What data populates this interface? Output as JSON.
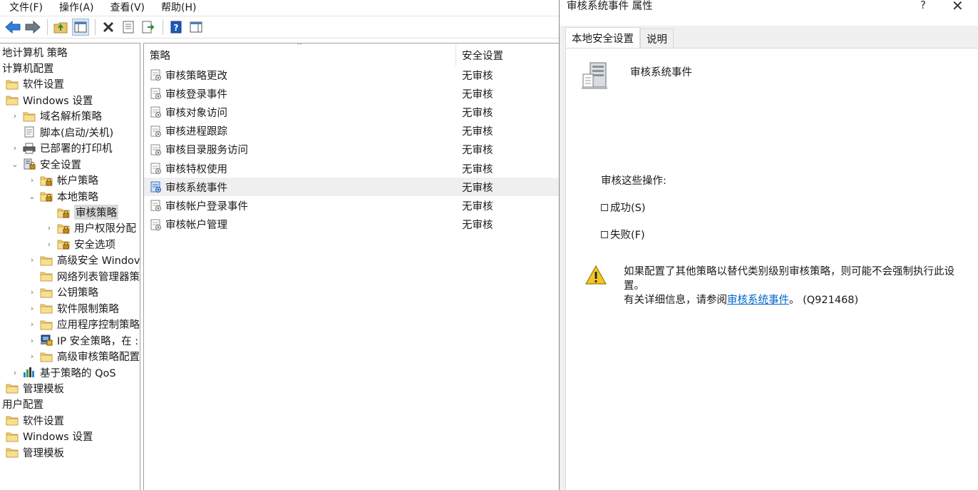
{
  "menu": [
    "文件(F)",
    "操作(A)",
    "查看(V)",
    "帮助(H)"
  ],
  "tree": {
    "items": [
      {
        "label": "地计算机 策略",
        "level": 0,
        "chevron": "",
        "icon": "none"
      },
      {
        "label": "计算机配置",
        "level": 0,
        "chevron": "",
        "icon": "none"
      },
      {
        "label": "软件设置",
        "level": 1,
        "chevron": "",
        "icon": "folder"
      },
      {
        "label": "Windows 设置",
        "level": 1,
        "chevron": "",
        "icon": "folder"
      },
      {
        "label": "域名解析策略",
        "level": 2,
        "chevron": ">",
        "icon": "folder"
      },
      {
        "label": "脚本(启动/关机)",
        "level": 2,
        "chevron": "",
        "icon": "script"
      },
      {
        "label": "已部署的打印机",
        "level": 2,
        "chevron": ">",
        "icon": "printer"
      },
      {
        "label": "安全设置",
        "level": 2,
        "chevron": "v",
        "icon": "security"
      },
      {
        "label": "帐户策略",
        "level": 3,
        "chevron": ">",
        "icon": "lockfolder"
      },
      {
        "label": "本地策略",
        "level": 3,
        "chevron": "v",
        "icon": "lockfolder"
      },
      {
        "label": "审核策略",
        "level": 4,
        "chevron": "",
        "icon": "lockfolder",
        "selected": true
      },
      {
        "label": "用户权限分配",
        "level": 4,
        "chevron": ">",
        "icon": "lockfolder"
      },
      {
        "label": "安全选项",
        "level": 4,
        "chevron": ">",
        "icon": "lockfolder"
      },
      {
        "label": "高级安全 Windov",
        "level": 3,
        "chevron": ">",
        "icon": "folder"
      },
      {
        "label": "网络列表管理器策",
        "level": 3,
        "chevron": "",
        "icon": "folder"
      },
      {
        "label": "公钥策略",
        "level": 3,
        "chevron": ">",
        "icon": "folder"
      },
      {
        "label": "软件限制策略",
        "level": 3,
        "chevron": ">",
        "icon": "folder"
      },
      {
        "label": "应用程序控制策略",
        "level": 3,
        "chevron": ">",
        "icon": "folder"
      },
      {
        "label": "IP 安全策略，在 :",
        "level": 3,
        "chevron": ">",
        "icon": "ipsec"
      },
      {
        "label": "高级审核策略配置",
        "level": 3,
        "chevron": ">",
        "icon": "folder"
      },
      {
        "label": "基于策略的 QoS",
        "level": 2,
        "chevron": ">",
        "icon": "chart"
      },
      {
        "label": "管理模板",
        "level": 1,
        "chevron": "",
        "icon": "folder"
      },
      {
        "label": "用户配置",
        "level": 0,
        "chevron": "",
        "icon": "none"
      },
      {
        "label": "软件设置",
        "level": 1,
        "chevron": "",
        "icon": "folder"
      },
      {
        "label": "Windows 设置",
        "level": 1,
        "chevron": "",
        "icon": "folder"
      },
      {
        "label": "管理模板",
        "level": 1,
        "chevron": "",
        "icon": "folder"
      }
    ]
  },
  "list": {
    "columns": [
      "策略",
      "安全设置"
    ],
    "sort_glyph": "^",
    "rows": [
      {
        "name": "审核策略更改",
        "value": "无审核"
      },
      {
        "name": "审核登录事件",
        "value": "无审核"
      },
      {
        "name": "审核对象访问",
        "value": "无审核"
      },
      {
        "name": "审核进程跟踪",
        "value": "无审核"
      },
      {
        "name": "审核目录服务访问",
        "value": "无审核"
      },
      {
        "name": "审核特权使用",
        "value": "无审核"
      },
      {
        "name": "审核系统事件",
        "value": "无审核",
        "selected": true
      },
      {
        "name": "审核帐户登录事件",
        "value": "无审核"
      },
      {
        "name": "审核帐户管理",
        "value": "无审核"
      }
    ]
  },
  "dialog": {
    "title": "审核系统事件 属性",
    "help_glyph": "?",
    "close_glyph": "✕",
    "tabs": [
      {
        "label": "本地安全设置",
        "active": true
      },
      {
        "label": "说明",
        "active": false
      }
    ],
    "policy_name": "审核系统事件",
    "audit_label": "审核这些操作:",
    "checkboxes": [
      {
        "label": "成功(S)",
        "checked": false
      },
      {
        "label": "失败(F)",
        "checked": false
      }
    ],
    "warning_line1": "如果配置了其他策略以替代类别级别审核策略，则可能不会强制执行此设置。",
    "warning_prefix": "有关详细信息，请参阅",
    "warning_link": "审核系统事件",
    "warning_suffix": "。 (Q921468)"
  }
}
